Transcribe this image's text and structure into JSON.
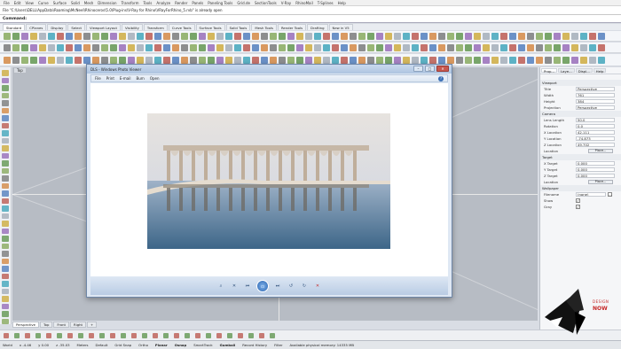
{
  "menu": [
    "File",
    "Edit",
    "View",
    "Curve",
    "Surface",
    "Solid",
    "Mesh",
    "Dimension",
    "Transform",
    "Tools",
    "Analyze",
    "Render",
    "Panels",
    "Paneling Tools",
    "Grid.de",
    "SectionTools",
    "V-Ray",
    "RhinoMail",
    "T-Splines",
    "Help"
  ],
  "command_history": "File \"C:\\Users\\DELL\\AppData\\Roaming\\McNeel\\Rhinoceros\\5.0\\Plug-ins\\V-Ray for Rhino\\VRayForRhino_5.rvb\" is already open",
  "command_prompt": "Command:",
  "toolbar_tabs": [
    "Standard",
    "CPlanes",
    "Display",
    "Select",
    "Viewport Layout",
    "Visibility",
    "Transform",
    "Curve Tools",
    "Surface Tools",
    "Solid Tools",
    "Mesh Tools",
    "Render Tools",
    "Drafting",
    "New in V5"
  ],
  "viewport": {
    "top_label": "Top",
    "tabs": [
      "Perspective",
      "Top",
      "Front",
      "Right"
    ]
  },
  "viewer": {
    "title": "DLS - Windows Photo Viewer",
    "menu": [
      "File",
      "Print",
      "E-mail",
      "Burn",
      "Open"
    ],
    "help_symbol": "?",
    "controls": [
      "zoom",
      "actual-size",
      "previous",
      "slideshow",
      "next",
      "rotate-left",
      "rotate-right",
      "delete"
    ]
  },
  "panel": {
    "tabs": [
      "Prop...",
      "Laye...",
      "Displ...",
      "Help"
    ],
    "viewport_section": "Viewport",
    "title_label": "Title",
    "title_value": "Perspective",
    "width_label": "Width",
    "width_value": "761",
    "height_label": "Height",
    "height_value": "384",
    "projection_label": "Projection",
    "projection_value": "Perspective",
    "camera_section": "Camera",
    "lens_label": "Lens Length",
    "lens_value": "50.0",
    "rotation_label": "Rotation",
    "rotation_value": "0.0",
    "xloc_label": "X Location",
    "xloc_value": "42.111",
    "yloc_label": "Y Location",
    "yloc_value": "-74.873",
    "zloc_label": "Z Location",
    "zloc_value": "49.702",
    "location_label": "Location",
    "place_button": "Place...",
    "target_section": "Target",
    "xtarget_label": "X Target",
    "xtarget_value": "0.000",
    "ytarget_label": "Y Target",
    "ytarget_value": "0.000",
    "ztarget_label": "Z Target",
    "ztarget_value": "0.000",
    "target_location_label": "Location",
    "place_button2": "Place...",
    "wallpaper_section": "Wallpaper",
    "filename_label": "Filename",
    "filename_value": "(none)",
    "show_label": "Show",
    "gray_label": "Gray"
  },
  "osnap": [
    "End",
    "Near",
    "Point",
    "Mid",
    "Cen",
    "Int",
    "Perp",
    "Tan",
    "Quad",
    "Knot",
    "Vertex",
    "Project",
    "Disable"
  ],
  "status": {
    "cplane": "World",
    "x": "x -4.46",
    "y": "y 0.00",
    "z": "z -35.03",
    "units": "Meters",
    "layer": "Default",
    "grid_snap": "Grid Snap",
    "ortho": "Ortho",
    "planar": "Planar",
    "osnap": "Osnap",
    "smarttrack": "SmartTrack",
    "gumball": "Gumball",
    "record_history": "Record History",
    "filter": "Filter",
    "memory": "Available physical memory: 14335 MB"
  },
  "logo": {
    "text1": "DESIGN",
    "text2": "NOW"
  },
  "colors": {
    "viewport_bg": "#b7bcc4",
    "viewer_chrome": "#dfe8f4",
    "accent_blue": "#2a64b0",
    "logo_red": "#c62828"
  }
}
